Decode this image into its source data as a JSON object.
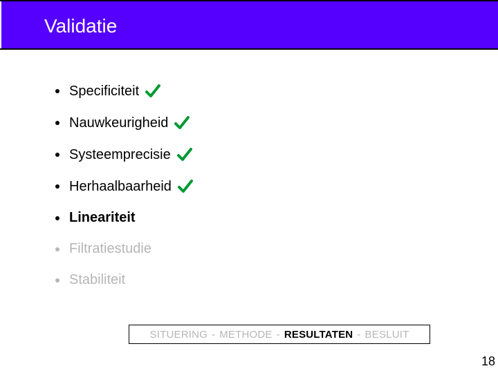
{
  "title": "Validatie",
  "items": [
    {
      "label": "Specificiteit",
      "checked": true,
      "bold": false,
      "dim": false
    },
    {
      "label": "Nauwkeurigheid",
      "checked": true,
      "bold": false,
      "dim": false
    },
    {
      "label": "Systeemprecisie",
      "checked": true,
      "bold": false,
      "dim": false
    },
    {
      "label": "Herhaalbaarheid",
      "checked": true,
      "bold": false,
      "dim": false
    },
    {
      "label": "Lineariteit",
      "checked": false,
      "bold": true,
      "dim": false
    },
    {
      "label": "Filtratiestudie",
      "checked": false,
      "bold": false,
      "dim": true
    },
    {
      "label": "Stabiliteit",
      "checked": false,
      "bold": false,
      "dim": true
    }
  ],
  "breadcrumb": {
    "parts": [
      "SITUERING",
      "METHODE",
      "RESULTATEN",
      "BESLUIT"
    ],
    "active_index": 2,
    "separator": "-"
  },
  "colors": {
    "title_bg": "#5500ff",
    "check": "#009933",
    "dim": "#b6b6b6"
  },
  "page_number": "18"
}
